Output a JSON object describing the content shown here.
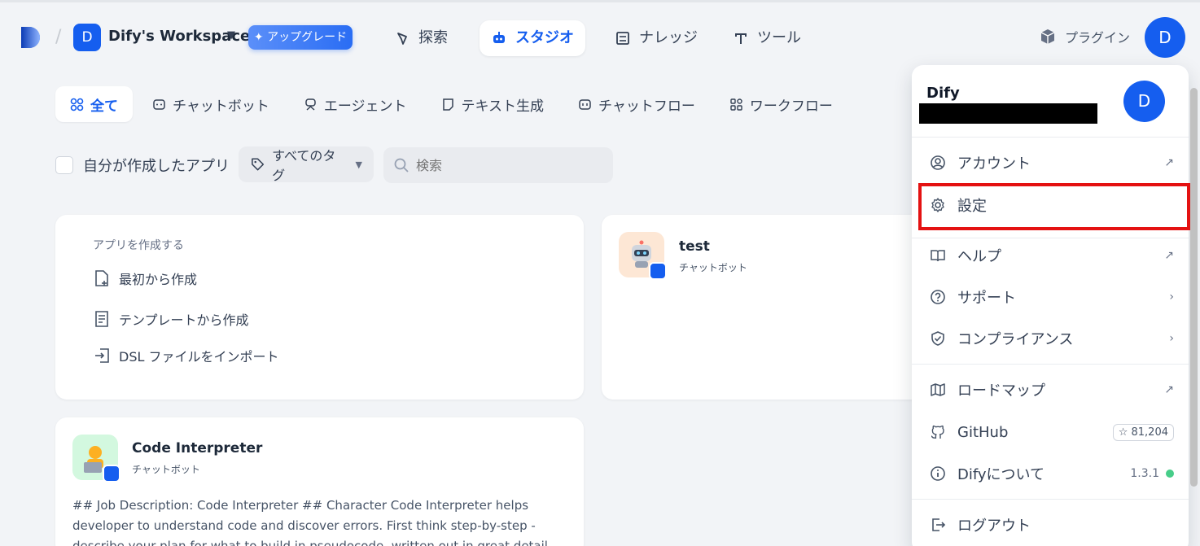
{
  "workspace": {
    "badge": "D",
    "name": "Dify's Workspace",
    "upgrade_label": "✦ アップグレード"
  },
  "nav": {
    "explore": "探索",
    "studio": "スタジオ",
    "knowledge": "ナレッジ",
    "tools": "ツール"
  },
  "plugin_label": "プラグイン",
  "user_avatar": "D",
  "tabs": [
    "全て",
    "チャットボット",
    "エージェント",
    "テキスト生成",
    "チャットフロー",
    "ワークフロー"
  ],
  "filters": {
    "mine_label": "自分が作成したアプリ",
    "tag_label": "すべてのタグ",
    "search_placeholder": "検索"
  },
  "create": {
    "title": "アプリを作成する",
    "options": [
      "最初から作成",
      "テンプレートから作成",
      "DSL ファイルをインポート"
    ]
  },
  "apps": [
    {
      "name": "test",
      "type": "チャットボット"
    },
    {
      "name": "Code Interpreter",
      "type": "チャットボット",
      "description": "## Job Description: Code Interpreter ## Character Code Interpreter helps developer to understand code and discover errors. First think step-by-step - describe your plan for what to build in pseudocode, written out in great detail"
    }
  ],
  "menu": {
    "user_name": "Dify",
    "avatar": "D",
    "items": {
      "account": "アカウント",
      "settings": "設定",
      "help": "ヘルプ",
      "support": "サポート",
      "compliance": "コンプライアンス",
      "roadmap": "ロードマップ",
      "github": "GitHub",
      "github_stars": "☆ 81,204",
      "about": "Difyについて",
      "version": "1.3.1",
      "logout": "ログアウト"
    }
  },
  "colors": {
    "accent": "#155eef",
    "highlight": "#e41111"
  }
}
